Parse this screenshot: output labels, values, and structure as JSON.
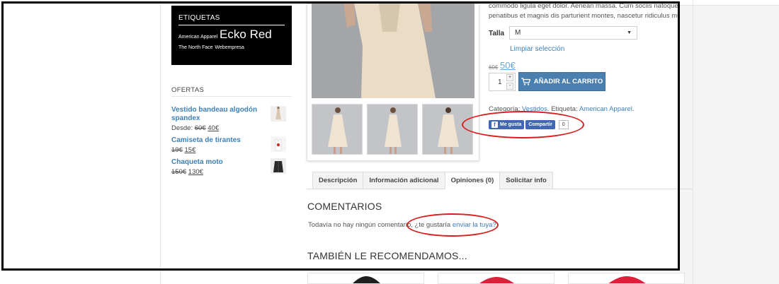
{
  "sidebar": {
    "tags_title": "ETIQUETAS",
    "tags": [
      {
        "label": "American Apparel",
        "size": "small"
      },
      {
        "label": "Ecko Red",
        "size": "large"
      },
      {
        "label": "The North Face",
        "size": "small"
      },
      {
        "label": "Webempresa",
        "size": "small"
      }
    ],
    "offers_title": "OFERTAS",
    "offers": [
      {
        "name": "Vestido bandeau algodón spandex",
        "prefix": "Desde: ",
        "old_price": "60€",
        "new_price": "40€"
      },
      {
        "name": "Camiseta de tirantes",
        "prefix": "",
        "old_price": "19€",
        "new_price": "15€"
      },
      {
        "name": "Chaqueta moto",
        "prefix": "",
        "old_price": "150€",
        "new_price": "130€"
      }
    ]
  },
  "product": {
    "desc_line1": "commodo ligula eget dolor. Aenean massa. Cum sociis natoque",
    "desc_line2": "penatibus et magnis dis parturient montes, nascetur ridiculus mus",
    "size_label": "Talla",
    "size_value": "M",
    "clear_selection": "Limpiar selección",
    "old_price": "60€",
    "new_price": "50€",
    "quantity": "1",
    "qty_plus": "+",
    "qty_minus": "-",
    "add_to_cart": "AÑADIR AL CARRITO",
    "category_label": "Categoría: ",
    "category_value": "Vestidos",
    "tag_label": ". Etiqueta: ",
    "tag_value": "American Apparel",
    "tag_end": "."
  },
  "social": {
    "like_label": "Me gusta",
    "share_label": "Compartir",
    "count": "0"
  },
  "tabs": [
    {
      "label": "Descripción",
      "active": false
    },
    {
      "label": "Información adicional",
      "active": false
    },
    {
      "label": "Opiniones (0)",
      "active": true
    },
    {
      "label": "Solicitar info",
      "active": false
    }
  ],
  "comments": {
    "title": "COMENTARIOS",
    "text": "Todavía no hay ningún comentario, ¿te gustaría ",
    "link": "enviar la tuya?"
  },
  "recommend": {
    "title": "TAMBIÉN LE RECOMENDAMOS..."
  },
  "colors": {
    "link": "#3f7fb4",
    "button": "#4a7fb0",
    "facebook": "#4267b2",
    "annotation_red": "#d81e1e",
    "annotation_frame": "#000000"
  }
}
